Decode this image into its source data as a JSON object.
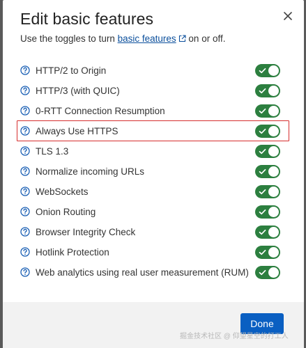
{
  "dialog": {
    "title": "Edit basic features",
    "subtitle_before": "Use the toggles to turn",
    "subtitle_link": "basic features",
    "subtitle_after": "on or off.",
    "done_label": "Done"
  },
  "features": [
    {
      "label": "HTTP/2 to Origin",
      "enabled": true
    },
    {
      "label": "HTTP/3 (with QUIC)",
      "enabled": true
    },
    {
      "label": "0-RTT Connection Resumption",
      "enabled": true
    },
    {
      "label": "Always Use HTTPS",
      "enabled": true,
      "highlighted": true
    },
    {
      "label": "TLS 1.3",
      "enabled": true
    },
    {
      "label": "Normalize incoming URLs",
      "enabled": true
    },
    {
      "label": "WebSockets",
      "enabled": true
    },
    {
      "label": "Onion Routing",
      "enabled": true
    },
    {
      "label": "Browser Integrity Check",
      "enabled": true
    },
    {
      "label": "Hotlink Protection",
      "enabled": true
    },
    {
      "label": "Web analytics using real user measurement (RUM)",
      "enabled": true
    }
  ],
  "icons": {
    "close": "close-icon",
    "external_link": "external-link-icon",
    "help": "help-icon",
    "toggle_check": "check-icon"
  },
  "colors": {
    "toggle_on": "#2c7f3f",
    "link": "#0b4f9c",
    "primary_button": "#0a5fc2",
    "highlight_border": "#d62d2d"
  },
  "watermark": "掘金技术社区 @ 仰望星空的打工人"
}
